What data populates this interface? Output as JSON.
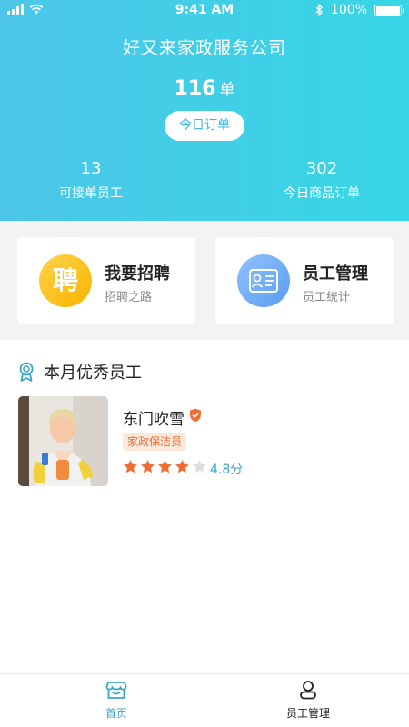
{
  "status_bar": {
    "time": "9:41 AM",
    "battery": "100%"
  },
  "header": {
    "company": "好又来家政服务公司",
    "orders_count": "116",
    "orders_unit": "单",
    "today_button": "今日订单",
    "stats": [
      {
        "value": "13",
        "label": "可接单员工"
      },
      {
        "value": "302",
        "label": "今日商品订单"
      }
    ]
  },
  "cards": [
    {
      "icon_char": "聘",
      "title": "我要招聘",
      "subtitle": "招聘之路"
    },
    {
      "title": "员工管理",
      "subtitle": "员工统计"
    }
  ],
  "section": {
    "title": "本月优秀员工"
  },
  "employee": {
    "name": "东门吹雪",
    "tag": "家政保洁员",
    "stars": 4,
    "max_stars": 5,
    "rating": "4.8分"
  },
  "tabbar": {
    "home": "首页",
    "staff": "员工管理"
  },
  "colors": {
    "accent": "#37a6c9",
    "header_start": "#4cc6e8",
    "header_end": "#37d6e6",
    "star": "#ef6c33",
    "star_empty": "#dddddd"
  }
}
